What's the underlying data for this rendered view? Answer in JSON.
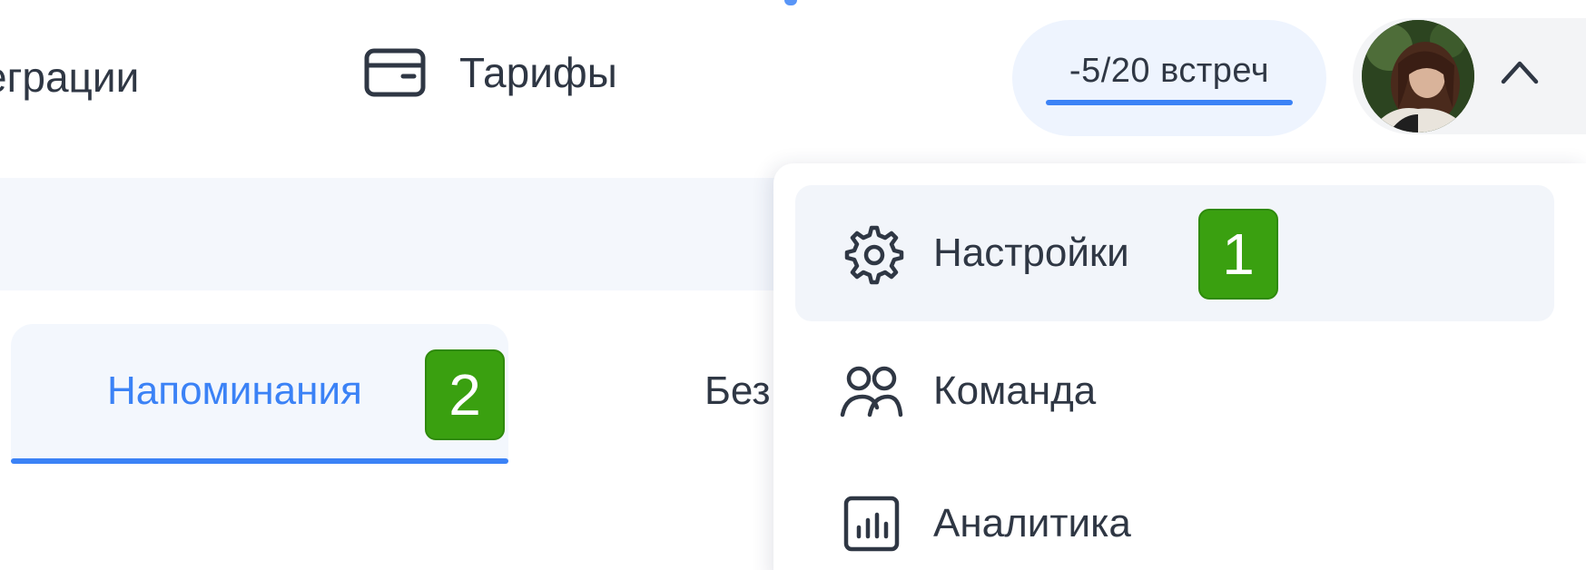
{
  "header": {
    "nav": [
      {
        "label": "еграции",
        "icon": "integrations-icon"
      },
      {
        "label": "Тарифы",
        "icon": "card-icon"
      }
    ],
    "quota": {
      "text": "-5/20 встреч"
    },
    "user": {
      "avatar": "avatar",
      "toggle_icon": "chevron-up-icon"
    }
  },
  "tabs": [
    {
      "label": "Напоминания",
      "active": true
    },
    {
      "label": "Без",
      "active": false
    }
  ],
  "dropdown": {
    "items": [
      {
        "label": "Настройки",
        "icon": "gear-icon",
        "hovered": true
      },
      {
        "label": "Команда",
        "icon": "team-icon",
        "hovered": false
      },
      {
        "label": "Аналитика",
        "icon": "analytics-icon",
        "hovered": false
      }
    ]
  },
  "badges": [
    "1",
    "2"
  ],
  "colors": {
    "accent": "#3b82f6",
    "badge": "#3aa010",
    "text": "#2f3744",
    "pill_bg": "#eef4fe"
  }
}
